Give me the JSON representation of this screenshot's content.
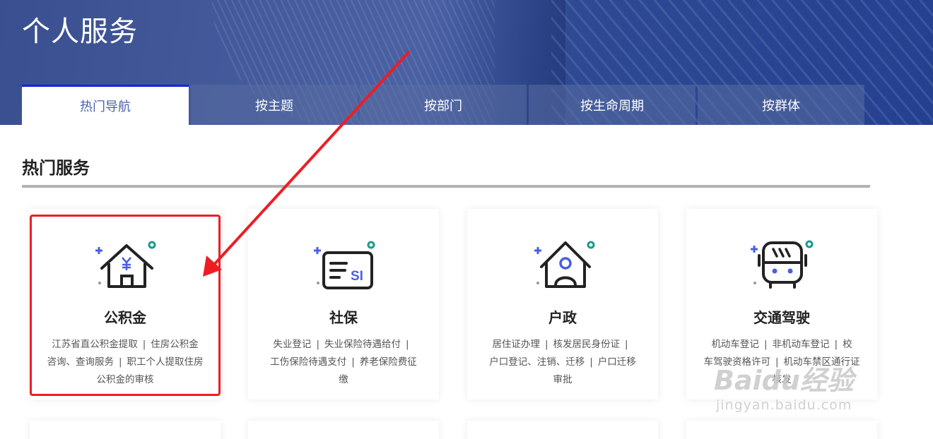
{
  "page": {
    "title": "个人服务"
  },
  "tabs": [
    {
      "label": "热门导航",
      "active": true
    },
    {
      "label": "按主题",
      "active": false
    },
    {
      "label": "按部门",
      "active": false
    },
    {
      "label": "按生命周期",
      "active": false
    },
    {
      "label": "按群体",
      "active": false
    }
  ],
  "section": {
    "title": "热门服务"
  },
  "cards": [
    {
      "name": "公积金",
      "icon": "house-yuan-icon",
      "lines": [
        [
          "江苏省直公积金提取",
          "住房公积金"
        ],
        [
          "咨询、查询服务",
          "职工个人提取住房"
        ],
        [
          "公积金的审核"
        ]
      ]
    },
    {
      "name": "社保",
      "icon": "social-insurance-card-icon",
      "icon_text": "SI",
      "lines": [
        [
          "失业登记",
          "失业保险待遇给付",
          ""
        ],
        [
          "工伤保险待遇支付",
          "养老保险费征"
        ],
        [
          "缴"
        ]
      ]
    },
    {
      "name": "户政",
      "icon": "house-person-icon",
      "lines": [
        [
          "居住证办理",
          "核发居民身份证",
          ""
        ],
        [
          "户口登记、注销、迁移",
          "户口迁移"
        ],
        [
          "审批"
        ]
      ]
    },
    {
      "name": "交通驾驶",
      "icon": "bus-icon",
      "lines": [
        [
          "机动车登记",
          "非机动车登记",
          "校"
        ],
        [
          "车驾驶资格许可",
          "机动车禁区通行证"
        ],
        [
          "核发"
        ]
      ]
    }
  ],
  "watermark": {
    "brand": "Baidu经验",
    "url": "jingyan.baidu.com"
  },
  "colors": {
    "accent": "#4a5fb0",
    "icon_primary": "#4a5fe0",
    "icon_dot": "#1a9a8a",
    "highlight": "#ee1d24",
    "tab_active_border": "#1226e0"
  }
}
